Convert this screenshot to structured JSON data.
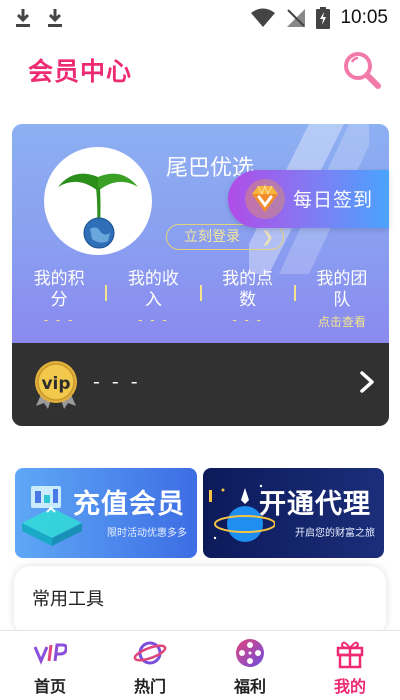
{
  "status_bar": {
    "time": "10:05"
  },
  "header": {
    "title": "会员中心",
    "search_icon": "search-icon"
  },
  "member_card": {
    "username": "尾巴优选",
    "login_label": "立刻登录",
    "stats": [
      {
        "label": "我的积分",
        "value": "- - -"
      },
      {
        "label": "我的收入",
        "value": "- - -"
      },
      {
        "label": "我的点数",
        "value": "- - -"
      },
      {
        "label": "我的团队",
        "value": "点击查看"
      }
    ],
    "vip": {
      "badge": "vip",
      "value": "- - -"
    }
  },
  "signin": {
    "label": "每日签到"
  },
  "banners": {
    "recharge": {
      "title": "充值会员",
      "subtitle": "限时活动优惠多多"
    },
    "agent": {
      "title": "开通代理",
      "subtitle": "开启您的财富之旅"
    }
  },
  "tools": {
    "title": "常用工具"
  },
  "tabbar": {
    "tabs": [
      {
        "label": "首页",
        "icon": "vip-home-icon"
      },
      {
        "label": "热门",
        "icon": "planet-icon"
      },
      {
        "label": "福利",
        "icon": "film-reel-icon"
      },
      {
        "label": "我的",
        "icon": "gift-icon"
      }
    ],
    "active_index": 3
  },
  "colors": {
    "accent": "#ee2a73",
    "gold": "#f2e58c",
    "vip_bar": "#313131"
  }
}
